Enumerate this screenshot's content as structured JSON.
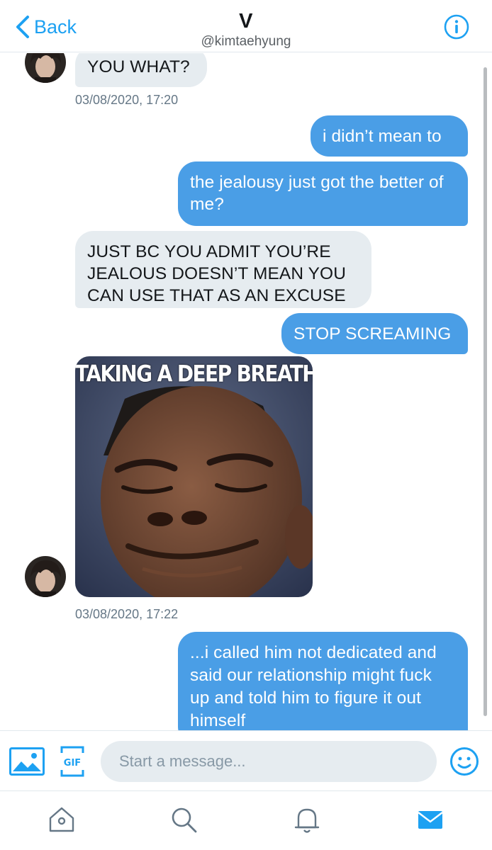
{
  "header": {
    "back_label": "Back",
    "title": "V",
    "handle": "@kimtaehyung"
  },
  "messages": [
    {
      "id": "m1",
      "direction": "received",
      "text": "YOU WHAT?"
    },
    {
      "id": "t1",
      "type": "timestamp",
      "text": "03/08/2020, 17:20"
    },
    {
      "id": "m2",
      "direction": "sent",
      "text": "i didn’t mean to"
    },
    {
      "id": "m3",
      "direction": "sent",
      "text": "the jealousy just got the better of me?"
    },
    {
      "id": "m4",
      "direction": "received",
      "text": "JUST BC YOU ADMIT YOU’RE JEALOUS DOESN’T MEAN YOU CAN USE THAT AS AN EXCUSE"
    },
    {
      "id": "m5",
      "direction": "sent",
      "text": "STOP SCREAMING"
    },
    {
      "id": "m6",
      "direction": "received",
      "type": "image",
      "caption": "TAKING A DEEP BREATH"
    },
    {
      "id": "t2",
      "type": "timestamp",
      "text": "03/08/2020, 17:22"
    },
    {
      "id": "m7",
      "direction": "sent",
      "text": "...i called him not dedicated and said our relationship might fuck up and told him to figure it out himself"
    }
  ],
  "composer": {
    "placeholder": "Start a message...",
    "media_icon": "image-icon",
    "gif_label": "GIF",
    "emoji_icon": "emoji-icon"
  },
  "tabbar": {
    "items": [
      {
        "name": "home",
        "icon": "home-icon"
      },
      {
        "name": "search",
        "icon": "search-icon"
      },
      {
        "name": "notifications",
        "icon": "bell-icon"
      },
      {
        "name": "messages",
        "icon": "envelope-icon",
        "active": true
      }
    ]
  },
  "colors": {
    "accent": "#1da1f2",
    "sent_bubble": "#4a9ee6",
    "received_bubble": "#e6ecf0",
    "inactive_icon": "#657786"
  }
}
